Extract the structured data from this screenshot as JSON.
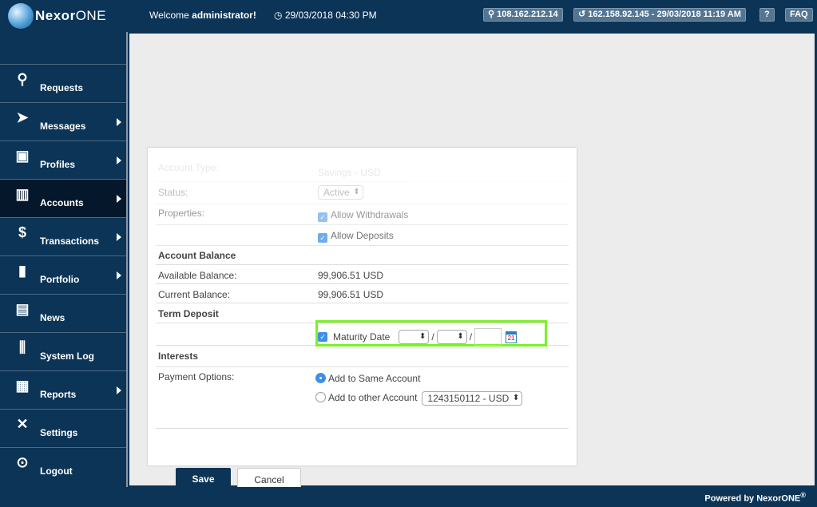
{
  "header": {
    "logo_main": "Nexor",
    "logo_one": "ONE",
    "welcome_prefix": "Welcome ",
    "welcome_user": "administrator!",
    "datetime": "29/03/2018 04:30 PM",
    "ip": "108.162.212.14",
    "last_login": "162.158.92.145 - 29/03/2018 11:19 AM",
    "help": "?",
    "faq": "FAQ"
  },
  "sidebar": {
    "items": [
      {
        "label": "Requests",
        "icon": "lamp-icon"
      },
      {
        "label": "Messages",
        "icon": "paper-plane-icon"
      },
      {
        "label": "Profiles",
        "icon": "address-book-icon"
      },
      {
        "label": "Accounts",
        "icon": "binders-icon"
      },
      {
        "label": "Transactions",
        "icon": "money-bag-icon"
      },
      {
        "label": "Portfolio",
        "icon": "briefcase-icon"
      },
      {
        "label": "News",
        "icon": "radio-icon"
      },
      {
        "label": "System Log",
        "icon": "sliders-icon"
      },
      {
        "label": "Reports",
        "icon": "presentation-icon"
      },
      {
        "label": "Settings",
        "icon": "tools-icon"
      },
      {
        "label": "Logout",
        "icon": "unlock-icon"
      }
    ]
  },
  "form": {
    "account_type_label": "Account Type:",
    "account_type_value": "Savings - USD",
    "status_label": "Status:",
    "status_value": "Active",
    "properties_label": "Properties:",
    "allow_withdrawals": "Allow Withdrawals",
    "allow_deposits": "Allow Deposits",
    "balance_heading": "Account Balance",
    "available_label": "Available Balance:",
    "available_value": "99,906.51 USD",
    "current_label": "Current Balance:",
    "current_value": "99,906.51 USD",
    "term_heading": "Term Deposit",
    "maturity_label": "Maturity Date",
    "date_sep": "/",
    "calendar_day": "21",
    "interests_heading": "Interests",
    "payment_label": "Payment Options:",
    "opt_same": "Add to Same Account",
    "opt_other": "Add to other Account",
    "other_account": "1243150112 - USD",
    "save": "Save",
    "cancel": "Cancel"
  },
  "footer": {
    "powered": "Powered by NexorONE",
    "reg": "®"
  },
  "colors": {
    "navy": "#0b3456",
    "highlight": "#7cf12a",
    "checkbox": "#3f8fe8"
  }
}
